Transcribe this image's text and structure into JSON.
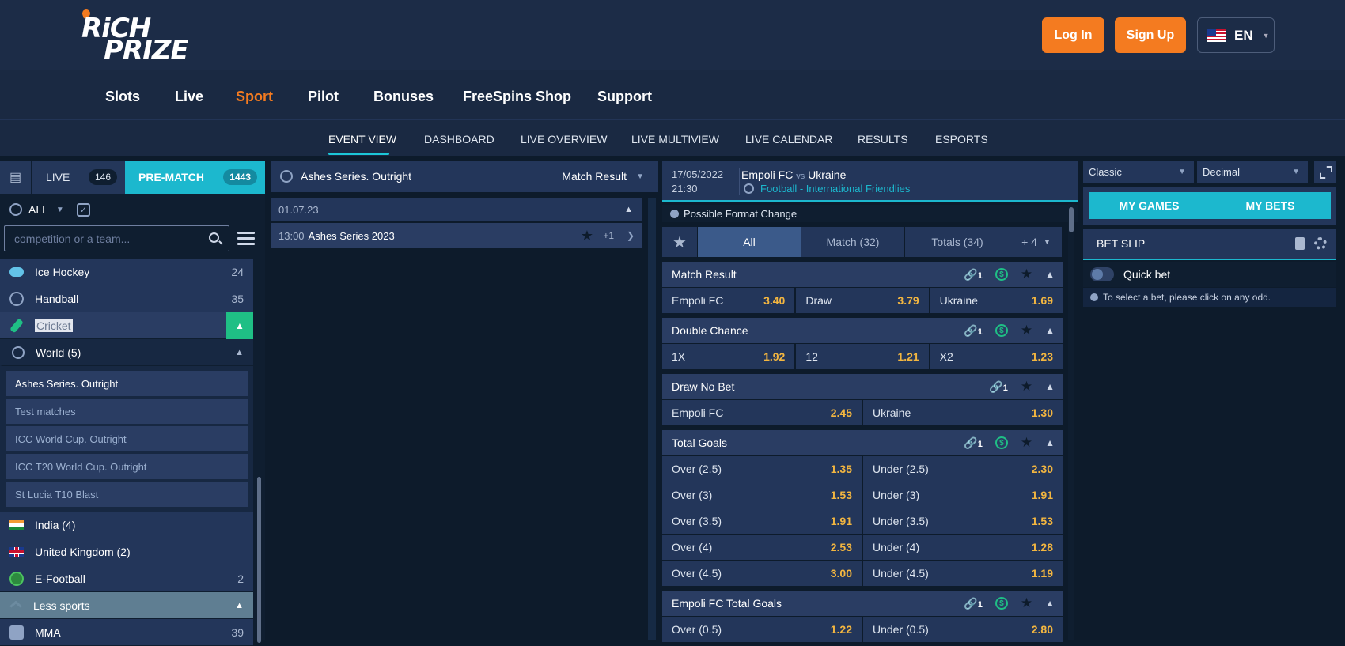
{
  "header": {
    "logo_line1": "RiCH",
    "logo_line2": "PRIZE",
    "login": "Log In",
    "signup": "Sign Up",
    "lang": "EN"
  },
  "mainnav": [
    "Slots",
    "Live",
    "Sport",
    "Pilot",
    "Bonuses",
    "FreeSpins Shop",
    "Support"
  ],
  "subnav": [
    "EVENT VIEW",
    "DASHBOARD",
    "LIVE OVERVIEW",
    "LIVE MULTIVIEW",
    "LIVE CALENDAR",
    "RESULTS",
    "ESPORTS"
  ],
  "left": {
    "tab_live": "LIVE",
    "live_count": "146",
    "tab_prematch": "PRE-MATCH",
    "prematch_count": "1443",
    "filter_all": "ALL",
    "search_placeholder": "competition or a team...",
    "sports": [
      {
        "name": "Ice Hockey",
        "count": "24"
      },
      {
        "name": "Handball",
        "count": "35"
      },
      {
        "name": "Cricket"
      },
      {
        "name": "World (5)"
      }
    ],
    "competitions": [
      "Ashes Series. Outright",
      "Test matches",
      "ICC World Cup. Outright",
      "ICC T20 World Cup. Outright",
      "St Lucia T10 Blast"
    ],
    "regions": [
      "India (4)",
      "United Kingdom (2)"
    ],
    "efootball": {
      "name": "E-Football",
      "count": "2"
    },
    "less": "Less sports",
    "mma": {
      "name": "MMA",
      "count": "39"
    }
  },
  "mid": {
    "title": "Ashes Series. Outright",
    "market_select": "Match Result",
    "date": "01.07.23",
    "event_time": "13:00",
    "event_name": "Ashes Series 2023",
    "event_more": "+1"
  },
  "match": {
    "date": "17/05/2022",
    "time": "21:30",
    "home": "Empoli FC",
    "vs": "vs",
    "away": "Ukraine",
    "league": "Football - International Friendlies",
    "notice": "Possible Format Change",
    "tabs": {
      "all": "All",
      "match": "Match (32)",
      "totals": "Totals (34)",
      "more": "+ 4"
    },
    "markets": [
      {
        "title": "Match Result",
        "link": "1",
        "rows": [
          [
            [
              "Empoli FC",
              "3.40"
            ],
            [
              "Draw",
              "3.79"
            ],
            [
              "Ukraine",
              "1.69"
            ]
          ]
        ]
      },
      {
        "title": "Double Chance",
        "link": "1",
        "rows": [
          [
            [
              "1X",
              "1.92"
            ],
            [
              "12",
              "1.21"
            ],
            [
              "X2",
              "1.23"
            ]
          ]
        ]
      },
      {
        "title": "Draw No Bet",
        "link": "1",
        "rows": [
          [
            [
              "Empoli FC",
              "2.45"
            ],
            [
              "Ukraine",
              "1.30"
            ]
          ]
        ]
      },
      {
        "title": "Total Goals",
        "link": "1",
        "rows": [
          [
            [
              "Over (2.5)",
              "1.35"
            ],
            [
              "Under (2.5)",
              "2.30"
            ]
          ],
          [
            [
              "Over (3)",
              "1.53"
            ],
            [
              "Under (3)",
              "1.91"
            ]
          ],
          [
            [
              "Over (3.5)",
              "1.91"
            ],
            [
              "Under (3.5)",
              "1.53"
            ]
          ],
          [
            [
              "Over (4)",
              "2.53"
            ],
            [
              "Under (4)",
              "1.28"
            ]
          ],
          [
            [
              "Over (4.5)",
              "3.00"
            ],
            [
              "Under (4.5)",
              "1.19"
            ]
          ]
        ]
      },
      {
        "title": "Empoli FC Total Goals",
        "link": "1",
        "rows": [
          [
            [
              "Over (0.5)",
              "1.22"
            ],
            [
              "Under (0.5)",
              "2.80"
            ]
          ]
        ]
      }
    ]
  },
  "right": {
    "view_select": "Classic",
    "odds_select": "Decimal",
    "my_games": "MY GAMES",
    "my_bets": "MY BETS",
    "bet_slip": "BET SLIP",
    "quick_bet": "Quick bet",
    "hint": "To select a bet, please click on any odd."
  }
}
